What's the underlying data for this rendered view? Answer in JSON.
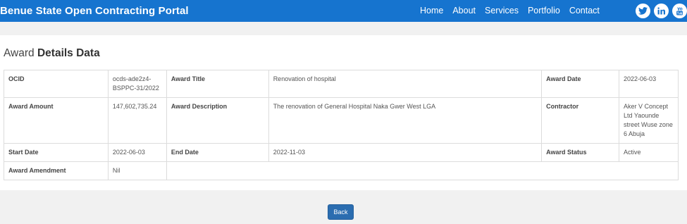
{
  "header": {
    "brand": "Benue State Open Contracting Portal",
    "nav": [
      "Home",
      "About",
      "Services",
      "Portfolio",
      "Contact"
    ],
    "social_icons": [
      "twitter-icon",
      "linkedin-icon",
      "youtube-icon"
    ],
    "accent_color": "#1674cf"
  },
  "page": {
    "title_light": "Award",
    "title_bold": "Details Data"
  },
  "details": {
    "ocid_label": "OCID",
    "ocid_value": "ocds-ade2z4-BSPPC-31/2022",
    "award_title_label": "Award Title",
    "award_title_value": "Renovation of hospital",
    "award_date_label": "Award Date",
    "award_date_value": "2022-06-03",
    "award_amount_label": "Award Amount",
    "award_amount_value": "147,602,735.24",
    "award_description_label": "Award Description",
    "award_description_value": "The renovation of General Hospital Naka Gwer West LGA",
    "contractor_label": "Contractor",
    "contractor_value": "Aker V Concept Ltd Yaounde street Wuse zone 6 Abuja",
    "start_date_label": "Start Date",
    "start_date_value": "2022-06-03",
    "end_date_label": "End Date",
    "end_date_value": "2022-11-03",
    "award_status_label": "Award Status",
    "award_status_value": "Active",
    "award_amendment_label": "Award Amendment",
    "award_amendment_value": "Nil"
  },
  "footer": {
    "back_label": "Back"
  }
}
